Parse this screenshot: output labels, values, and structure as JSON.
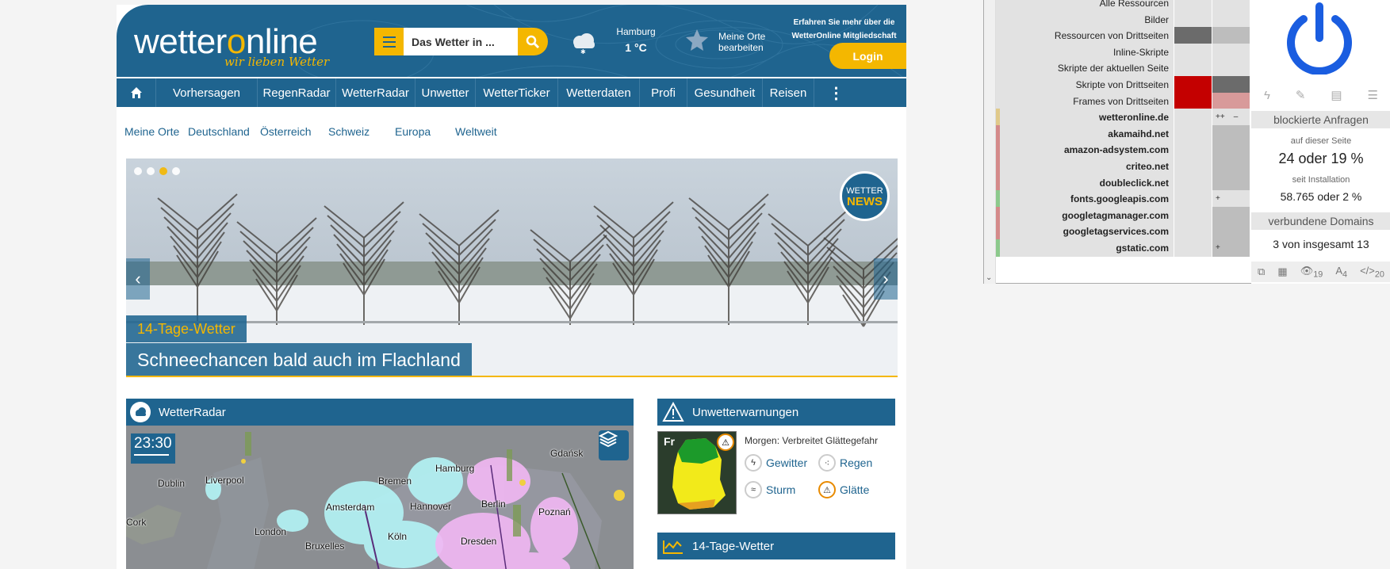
{
  "site": {
    "logo": {
      "pre": "wetter",
      "o": "o",
      "post": "nline",
      "tagline": "wir lieben Wetter"
    },
    "search": {
      "placeholder": "Das Wetter in ..."
    },
    "current": {
      "city": "Hamburg",
      "temp": "1 °C"
    },
    "places_link": "Meine Orte bearbeiten",
    "membership_text": "Erfahren Sie mehr über die WetterOnline Mitgliedschaft",
    "login_label": "Login",
    "nav": [
      {
        "label": "Vorhersagen",
        "w": 128
      },
      {
        "label": "RegenRadar",
        "w": 99
      },
      {
        "label": "WetterRadar",
        "w": 100
      },
      {
        "label": "Unwetter",
        "w": 76
      },
      {
        "label": "WetterTicker",
        "w": 104
      },
      {
        "label": "Wetterdaten",
        "w": 103
      },
      {
        "label": "Profi",
        "w": 60
      },
      {
        "label": "Gesundheit",
        "w": 95
      },
      {
        "label": "Reisen",
        "w": 65
      }
    ],
    "subnav": [
      "Meine Orte",
      "Deutschland",
      "Österreich",
      "Schweiz",
      "Europa",
      "Weltweit"
    ],
    "slider": {
      "tag": "14-Tage-Wetter",
      "title": "Schneechancen bald auch im Flachland",
      "badge_top": "WETTER",
      "badge_bottom": "NEWS",
      "dots": 4,
      "active_dot": 2
    },
    "radar": {
      "title": "WetterRadar",
      "time": "23:30",
      "cities": [
        {
          "name": "Dublin"
        },
        {
          "name": "Liverpool"
        },
        {
          "name": "Cork"
        },
        {
          "name": "London"
        },
        {
          "name": "Amsterdam"
        },
        {
          "name": "Bremen"
        },
        {
          "name": "Hamburg"
        },
        {
          "name": "Hannover"
        },
        {
          "name": "Berlin"
        },
        {
          "name": "Poznań"
        },
        {
          "name": "Bruxelles"
        },
        {
          "name": "Köln"
        },
        {
          "name": "Dresden"
        },
        {
          "name": "Gdańsk"
        }
      ]
    },
    "warnings": {
      "title": "Unwetterwarnungen",
      "day": "Fr",
      "summary": "Morgen: Verbreitet Glättegefahr",
      "links": [
        "Gewitter",
        "Regen",
        "Sturm",
        "Glätte"
      ]
    },
    "trend": {
      "title": "14-Tage-Wetter"
    }
  },
  "extension": {
    "rows": [
      {
        "label": "Alle Ressourcen",
        "type": "cat",
        "c1": "#e2e2e2",
        "c2": "#e2e2e2",
        "t1": "",
        "t2": ""
      },
      {
        "label": "Bilder",
        "type": "cat",
        "c1": "#e2e2e2",
        "c2": "#e2e2e2",
        "t1": "",
        "t2": ""
      },
      {
        "label": "Ressourcen von Drittseiten",
        "type": "cat",
        "c1": "#6b6b6b",
        "c2": "#bdbdbd",
        "t1": "",
        "t2": ""
      },
      {
        "label": "Inline-Skripte",
        "type": "cat",
        "c1": "#e2e2e2",
        "c2": "#e2e2e2",
        "t1": "",
        "t2": ""
      },
      {
        "label": "Skripte der aktuellen Seite",
        "type": "cat",
        "c1": "#e2e2e2",
        "c2": "#e2e2e2",
        "t1": "",
        "t2": ""
      },
      {
        "label": "Skripte von Drittseiten",
        "type": "cat",
        "c1": "#c40000",
        "c2": "#6b6b6b",
        "t1": "",
        "t2": ""
      },
      {
        "label": "Frames von Drittseiten",
        "type": "cat",
        "c1": "#c40000",
        "c2": "#d89a9a",
        "t1": "",
        "t2": ""
      },
      {
        "label": "wetteronline.de",
        "type": "domain",
        "gutter": "#e0c98a",
        "c1": "#e2e2e2",
        "c2": "#e2e2e2",
        "t1": "",
        "t2": "++    –"
      },
      {
        "label": "akamaihd.net",
        "type": "domain",
        "gutter": "#d48a8a",
        "c1": "#e2e2e2",
        "c2": "#bdbdbd",
        "t1": "",
        "t2": "                –"
      },
      {
        "label": "amazon-adsystem.com",
        "type": "domain",
        "gutter": "#d48a8a",
        "c1": "#e2e2e2",
        "c2": "#bdbdbd",
        "t1": "",
        "t2": "                –"
      },
      {
        "label": "criteo.net",
        "type": "domain",
        "gutter": "#d48a8a",
        "c1": "#e2e2e2",
        "c2": "#bdbdbd",
        "t1": "",
        "t2": "                –"
      },
      {
        "label": "doubleclick.net",
        "type": "domain",
        "gutter": "#d48a8a",
        "c1": "#e2e2e2",
        "c2": "#bdbdbd",
        "t1": "",
        "t2": "                –"
      },
      {
        "label": "fonts.googleapis.com",
        "type": "domain",
        "gutter": "#8cc98c",
        "c1": "#e2e2e2",
        "c2": "#e2e2e2",
        "t1": "",
        "t2": "+"
      },
      {
        "label": "googletagmanager.com",
        "type": "domain",
        "gutter": "#d48a8a",
        "c1": "#e2e2e2",
        "c2": "#bdbdbd",
        "t1": "",
        "t2": "                –"
      },
      {
        "label": "googletagservices.com",
        "type": "domain",
        "gutter": "#d48a8a",
        "c1": "#e2e2e2",
        "c2": "#bdbdbd",
        "t1": "",
        "t2": "                –"
      },
      {
        "label": "gstatic.com",
        "type": "domain",
        "gutter": "#8cc98c",
        "c1": "#e2e2e2",
        "c2": "#bdbdbd",
        "t1": "",
        "t2": "+"
      }
    ],
    "blocked_title": "blockierte Anfragen",
    "on_page_label": "auf dieser Seite",
    "on_page_value": "24 oder 19 %",
    "since_install_label": "seit Installation",
    "since_install_value": "58.765 oder 2 %",
    "domains_title": "verbundene Domains",
    "domains_value": "3 von insgesamt 13",
    "bottom_badges": {
      "eye": "19",
      "font": "4",
      "code": "20"
    },
    "power_color": "#1a5de0"
  }
}
